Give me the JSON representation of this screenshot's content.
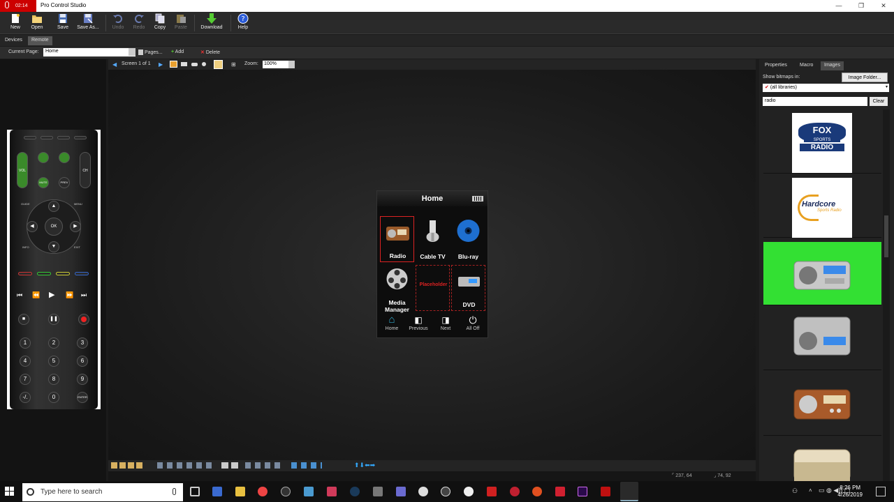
{
  "titlebar": {
    "recording": "02:14",
    "app_title": "Pro Control Studio",
    "minimize": "—",
    "restore": "❐",
    "close": "✕"
  },
  "toolbar": {
    "new": "New",
    "open": "Open",
    "save": "Save",
    "save_as": "Save As...",
    "undo": "Undo",
    "redo": "Redo",
    "copy": "Copy",
    "paste": "Paste",
    "download": "Download",
    "help": "Help"
  },
  "tabs": {
    "devices": "Devices",
    "remote": "Remote"
  },
  "pagebar": {
    "current_page_label": "Current Page:",
    "current_page_value": "Home",
    "pages": "Pages...",
    "add": "Add",
    "delete": "Delete"
  },
  "editbar": {
    "screen": "Screen 1 of 1",
    "zoom_label": "Zoom:",
    "zoom_value": "100%"
  },
  "phone": {
    "title": "Home",
    "cells": [
      {
        "label": "Radio"
      },
      {
        "label": "Cable TV"
      },
      {
        "label": "Blu-ray"
      },
      {
        "label": "Media Manager"
      },
      {
        "label": "Placeholder"
      },
      {
        "label": "DVD"
      }
    ],
    "nav": [
      "Home",
      "Previous",
      "Next",
      "All Off"
    ]
  },
  "remote_keys": [
    "1",
    "2",
    "3",
    "4",
    "5",
    "6",
    "7",
    "8",
    "9",
    "-/.",
    "0",
    "ENTER"
  ],
  "remote_labels": {
    "ok": "OK",
    "vol": "VOL",
    "ch": "CH",
    "mute": "MUTE",
    "prev": "PREV",
    "guide": "GUIDE",
    "menu": "MENU",
    "info": "INFO",
    "exit": "EXIT"
  },
  "status": {
    "pos": "237, 64",
    "size": "74, 92"
  },
  "right_panel": {
    "tabs": [
      "Properties",
      "Macro",
      "Images"
    ],
    "show_bitmaps_label": "Show bitmaps in:",
    "image_folder_button": "Image Folder...",
    "library_select": "(all libraries)",
    "search_value": "radio",
    "clear_button": "Clear",
    "images": [
      {
        "title": "FOX",
        "sub": "SPORTS",
        "tag": "RADIO"
      },
      {
        "title": "Hardcore",
        "sub": "Sports Radio"
      }
    ]
  },
  "taskbar": {
    "search_placeholder": "Type here to search",
    "time": "8:26 PM",
    "date": "4/26/2019"
  },
  "colors": {
    "accent_selected": "#33e033",
    "placeholder_red": "#dd2222",
    "title_red": "#cc0000"
  }
}
